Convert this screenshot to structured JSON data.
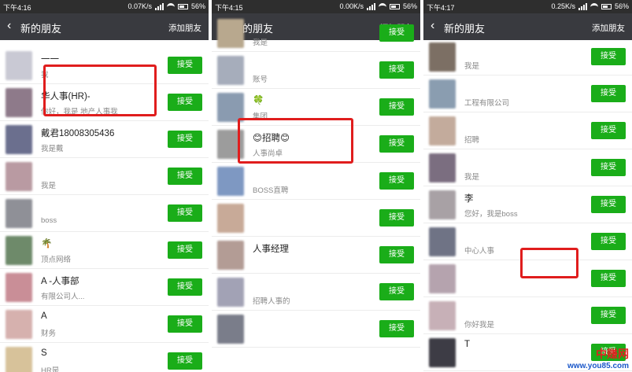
{
  "accent": "#1aad19",
  "highlight_color": "#e01d1d",
  "panels": [
    {
      "status": {
        "time": "下午4:16",
        "speed": "0.07K/s",
        "battery": "56%"
      },
      "title": "新的朋友",
      "add_label": "添加朋友",
      "rows": [
        {
          "name": "一一",
          "msg": "我",
          "accept": "接受",
          "avatar": "#c9c9d4"
        },
        {
          "name": "华人事(HR)-",
          "msg": "你好，我是    地产人事我",
          "accept": "接受",
          "avatar": "#8e7a8a"
        },
        {
          "name": "戴君18008305436",
          "msg": "我是戴",
          "accept": "接受",
          "avatar": "#6b6f8e"
        },
        {
          "name": "",
          "msg": "我是",
          "accept": "接受",
          "avatar": "#b99aa2"
        },
        {
          "name": "",
          "msg": "boss",
          "accept": "接受",
          "avatar": "#8f9097"
        },
        {
          "name": "🌴",
          "msg": "顶点网络",
          "accept": "接受",
          "avatar": "#6e8a6a"
        },
        {
          "name": "A   -人事部",
          "msg": "        有限公司人...",
          "accept": "接受",
          "avatar": "#c98e97"
        },
        {
          "name": "A",
          "msg": "财务",
          "accept": "接受",
          "avatar": "#d6b1ae"
        },
        {
          "name": "S",
          "msg": "HR是",
          "accept": "接受",
          "avatar": "#d7c29a"
        }
      ]
    },
    {
      "status": {
        "time": "下午4:15",
        "speed": "0.00K/s",
        "battery": "56%"
      },
      "title": "新的朋友",
      "add_label": "添加朋友",
      "rows": [
        {
          "name": "",
          "msg": "我是",
          "accept": "接受",
          "avatar": "#b8a88e"
        },
        {
          "name": "",
          "msg": "账号",
          "accept": "接受",
          "avatar": "#a6adbb"
        },
        {
          "name": "🍀",
          "msg": "集团",
          "accept": "接受",
          "avatar": "#8a9bb0"
        },
        {
          "name": "😊招聘😊",
          "msg": "人事尚卓",
          "accept": "接受",
          "avatar": "#9c9c9c"
        },
        {
          "name": "",
          "msg": "BOSS直聘",
          "accept": "接受",
          "avatar": "#7e98c2"
        },
        {
          "name": "",
          "msg": "",
          "accept": "接受",
          "avatar": "#c8aa98"
        },
        {
          "name": "人事经理",
          "msg": "",
          "accept": "接受",
          "avatar": "#b39c95"
        },
        {
          "name": "",
          "msg": "招聘人事的",
          "accept": "接受",
          "avatar": "#a2a2b5"
        },
        {
          "name": "",
          "msg": "",
          "accept": "接受",
          "avatar": "#7a7d8a"
        }
      ]
    },
    {
      "status": {
        "time": "下午4:17",
        "speed": "0.25K/s",
        "battery": "56%"
      },
      "title": "新的朋友",
      "add_label": "添加朋友",
      "rows": [
        {
          "name": "",
          "msg": "我是",
          "accept": "接受",
          "avatar": "#7c6f64"
        },
        {
          "name": "",
          "msg": "工程有限公司",
          "accept": "接受",
          "avatar": "#8a9db0"
        },
        {
          "name": "",
          "msg": "招聘",
          "accept": "接受",
          "avatar": "#c3ab9c"
        },
        {
          "name": "",
          "msg": "我是",
          "accept": "接受",
          "avatar": "#7b6e80"
        },
        {
          "name": "李",
          "msg": "您好，我是boss",
          "accept": "接受",
          "avatar": "#a8a1a5"
        },
        {
          "name": "",
          "msg": "中心人事",
          "accept": "接受",
          "avatar": "#6f7385"
        },
        {
          "name": "",
          "msg": "",
          "accept": "接受",
          "avatar": "#b5a3ae"
        },
        {
          "name": "",
          "msg": "你好我是",
          "accept": "接受",
          "avatar": "#c7b0b7"
        },
        {
          "name": "T",
          "msg": "",
          "accept": "接受",
          "avatar": "#3d3c45"
        }
      ]
    }
  ],
  "watermark": {
    "brand": "中赚网",
    "url": "www.you85.com"
  }
}
